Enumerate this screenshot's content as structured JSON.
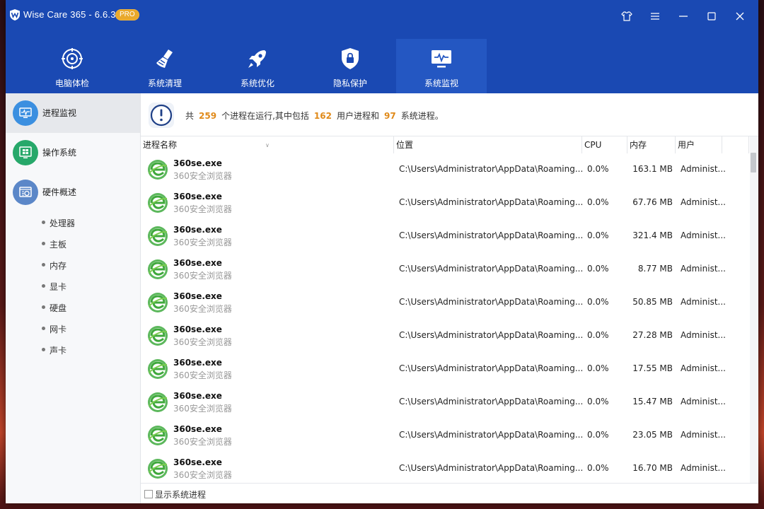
{
  "app": {
    "title": "Wise Care 365 - 6.6.3",
    "badge": "PRO"
  },
  "titlebar_buttons": [
    {
      "name": "skin-icon"
    },
    {
      "name": "menu-icon"
    },
    {
      "name": "minimize-icon"
    },
    {
      "name": "maximize-icon"
    },
    {
      "name": "close-icon"
    }
  ],
  "tabs": [
    {
      "label": "电脑体检",
      "icon": "target-icon",
      "active": false
    },
    {
      "label": "系统清理",
      "icon": "broom-icon",
      "active": false
    },
    {
      "label": "系统优化",
      "icon": "rocket-icon",
      "active": false
    },
    {
      "label": "隐私保护",
      "icon": "lock-icon",
      "active": false
    },
    {
      "label": "系统监视",
      "icon": "monitor-icon",
      "active": true
    }
  ],
  "sidebar": {
    "items": [
      {
        "label": "进程监视",
        "icon": "monitor-icon",
        "color": "#3b8fe0",
        "active": true
      },
      {
        "label": "操作系统",
        "icon": "windows-icon",
        "color": "#27a86a",
        "active": false
      },
      {
        "label": "硬件概述",
        "icon": "hardware-icon",
        "color": "#5b87c8",
        "active": false
      }
    ],
    "sub_items": [
      "处理器",
      "主板",
      "内存",
      "显卡",
      "硬盘",
      "网卡",
      "声卡"
    ]
  },
  "summary": {
    "prefix": "共",
    "total": "259",
    "mid1": "个进程在运行,其中包括",
    "user": "162",
    "mid2": "用户进程和",
    "system": "97",
    "suffix": "系统进程。"
  },
  "columns": [
    "进程名称",
    "位置",
    "CPU",
    "内存",
    "用户"
  ],
  "processes": [
    {
      "name": "360se.exe",
      "desc": "360安全浏览器",
      "path": "C:\\Users\\Administrator\\AppData\\Roaming...",
      "cpu": "0.0%",
      "mem": "163.1 MB",
      "user": "Administ..."
    },
    {
      "name": "360se.exe",
      "desc": "360安全浏览器",
      "path": "C:\\Users\\Administrator\\AppData\\Roaming...",
      "cpu": "0.0%",
      "mem": "67.76 MB",
      "user": "Administ..."
    },
    {
      "name": "360se.exe",
      "desc": "360安全浏览器",
      "path": "C:\\Users\\Administrator\\AppData\\Roaming...",
      "cpu": "0.0%",
      "mem": "321.4 MB",
      "user": "Administ..."
    },
    {
      "name": "360se.exe",
      "desc": "360安全浏览器",
      "path": "C:\\Users\\Administrator\\AppData\\Roaming...",
      "cpu": "0.0%",
      "mem": "8.77 MB",
      "user": "Administ..."
    },
    {
      "name": "360se.exe",
      "desc": "360安全浏览器",
      "path": "C:\\Users\\Administrator\\AppData\\Roaming...",
      "cpu": "0.0%",
      "mem": "50.85 MB",
      "user": "Administ..."
    },
    {
      "name": "360se.exe",
      "desc": "360安全浏览器",
      "path": "C:\\Users\\Administrator\\AppData\\Roaming...",
      "cpu": "0.0%",
      "mem": "27.28 MB",
      "user": "Administ..."
    },
    {
      "name": "360se.exe",
      "desc": "360安全浏览器",
      "path": "C:\\Users\\Administrator\\AppData\\Roaming...",
      "cpu": "0.0%",
      "mem": "17.55 MB",
      "user": "Administ..."
    },
    {
      "name": "360se.exe",
      "desc": "360安全浏览器",
      "path": "C:\\Users\\Administrator\\AppData\\Roaming...",
      "cpu": "0.0%",
      "mem": "15.47 MB",
      "user": "Administ..."
    },
    {
      "name": "360se.exe",
      "desc": "360安全浏览器",
      "path": "C:\\Users\\Administrator\\AppData\\Roaming...",
      "cpu": "0.0%",
      "mem": "23.05 MB",
      "user": "Administ..."
    },
    {
      "name": "360se.exe",
      "desc": "360安全浏览器",
      "path": "C:\\Users\\Administrator\\AppData\\Roaming...",
      "cpu": "0.0%",
      "mem": "16.70 MB",
      "user": "Administ..."
    }
  ],
  "footer": {
    "checkbox_label": "显示系统进程",
    "checked": false
  },
  "colors": {
    "header": "#1a49b3",
    "tab_active": "#2457c2",
    "accent_number": "#e08a1a",
    "badge": "#e9a92c"
  }
}
